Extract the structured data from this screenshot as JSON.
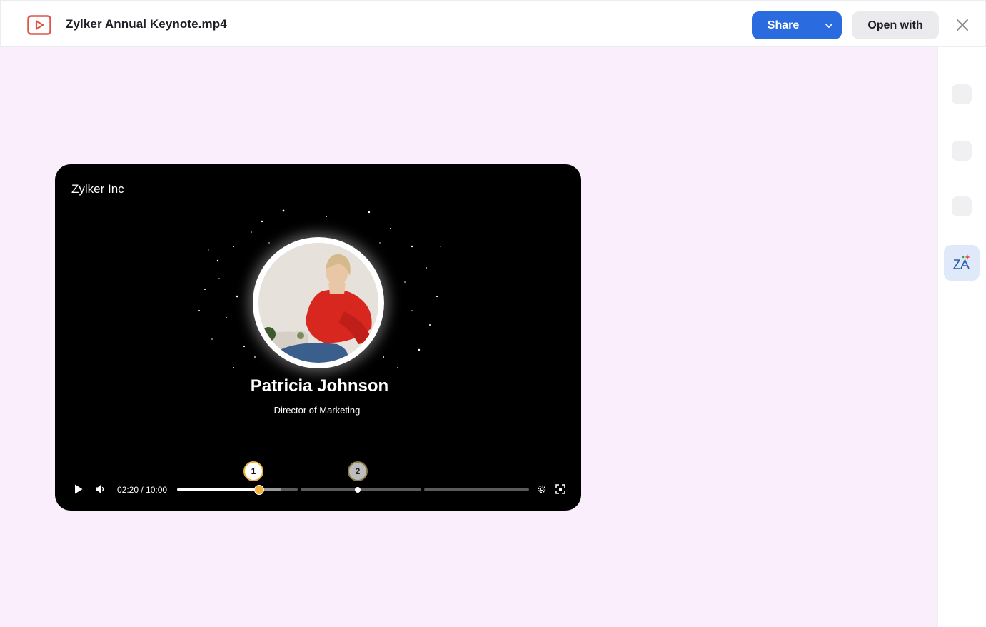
{
  "header": {
    "file_title": "Zylker Annual Keynote.mp4",
    "share_label": "Share",
    "open_with_label": "Open with",
    "icons": {
      "file": "video-file-icon",
      "dropdown": "chevron-down-icon",
      "close": "close-icon"
    }
  },
  "colors": {
    "accent": "#2a6be0",
    "stage_bg": "#faeefd",
    "file_icon": "#e0554a",
    "progress_thumb": "#f2b33d"
  },
  "video": {
    "brand": "Zylker Inc",
    "person_name": "Patricia Johnson",
    "person_title": "Director of Marketing",
    "current_time": "02:20",
    "duration": "10:00",
    "time_display": "02:20 / 10:00",
    "progress_fraction": 0.233,
    "markers": [
      {
        "label": "1"
      },
      {
        "label": "2"
      }
    ]
  },
  "sidebar": {
    "items": [
      {
        "icon": "placeholder-icon"
      },
      {
        "icon": "placeholder-icon"
      },
      {
        "icon": "placeholder-icon"
      },
      {
        "icon": "ai-translate-icon"
      }
    ]
  }
}
